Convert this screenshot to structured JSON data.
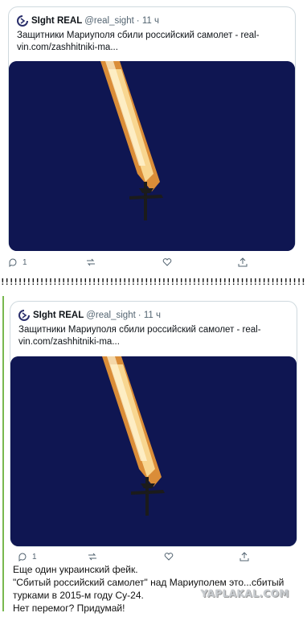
{
  "tweet": {
    "author_name": "SIght REAL",
    "author_handle": "@real_sight",
    "time": "· 11 ч",
    "text_line1": "Защитники Мариуполя сбили российский самолет - real-",
    "text_line2": "vin.com/zashhitniki-ma...",
    "reply_count": "1",
    "logo_icon": "real-sight-logo-icon"
  },
  "separator": "!!!!!!!!!!!!!!!!!!!!!!!!!!!!!!!!!!!!!!!!!!!!!!!!!!!!!!!!!!!!!!!!!!!!!!!!!!!!!!!!!!!",
  "comment": {
    "line1": "Еще один украинский фейк.",
    "line2": "\"Сбитый российский самолет\" над Мариуполем это...сбитый",
    "line3": "турками в 2015-м году Су-24.",
    "line4": "Нет перемог? Придумай!"
  },
  "watermark": "YAPLAKAL.COM",
  "colors": {
    "photo_bg": "#0f1652",
    "flame": "#f6a23a",
    "accent_green": "#78b84f"
  }
}
